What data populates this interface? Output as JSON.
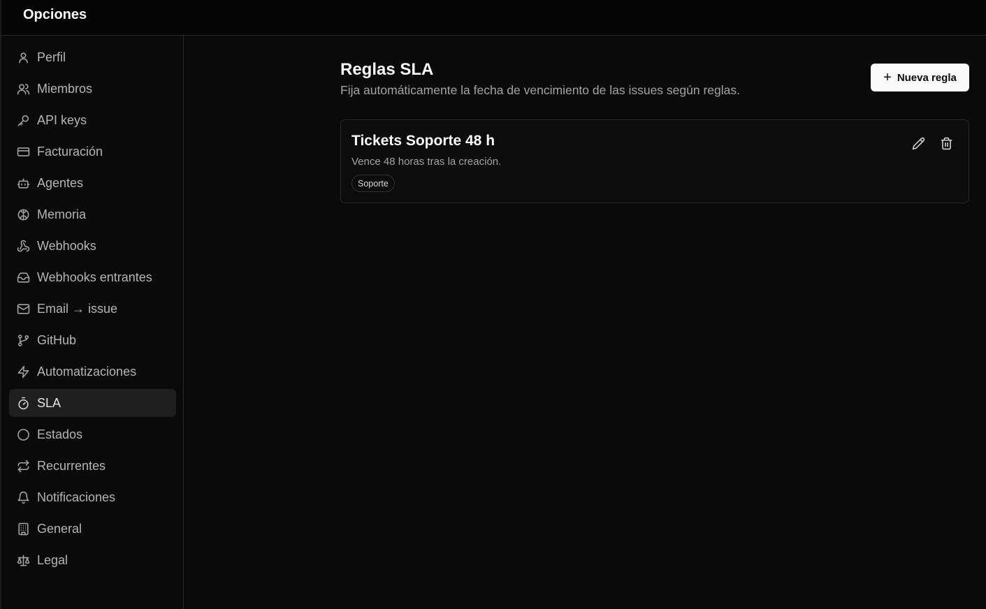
{
  "header": {
    "title": "Opciones"
  },
  "sidebar": {
    "items": [
      {
        "label": "Perfil",
        "icon": "user-icon"
      },
      {
        "label": "Miembros",
        "icon": "users-icon"
      },
      {
        "label": "API keys",
        "icon": "key-icon"
      },
      {
        "label": "Facturación",
        "icon": "credit-card-icon"
      },
      {
        "label": "Agentes",
        "icon": "bot-icon"
      },
      {
        "label": "Memoria",
        "icon": "brain-icon"
      },
      {
        "label": "Webhooks",
        "icon": "webhook-icon"
      },
      {
        "label": "Webhooks entrantes",
        "icon": "inbox-icon"
      },
      {
        "label": "Email → issue",
        "icon": "mail-icon"
      },
      {
        "label": "GitHub",
        "icon": "git-branch-icon"
      },
      {
        "label": "Automatizaciones",
        "icon": "zap-icon"
      },
      {
        "label": "SLA",
        "icon": "timer-icon",
        "active": true
      },
      {
        "label": "Estados",
        "icon": "circle-icon"
      },
      {
        "label": "Recurrentes",
        "icon": "repeat-icon"
      },
      {
        "label": "Notificaciones",
        "icon": "bell-icon"
      },
      {
        "label": "General",
        "icon": "building-icon"
      },
      {
        "label": "Legal",
        "icon": "scale-icon"
      }
    ]
  },
  "main": {
    "title": "Reglas SLA",
    "subtitle": "Fija automáticamente la fecha de vencimiento de las issues según reglas.",
    "new_button": "Nueva regla",
    "rules": [
      {
        "name": "Tickets Soporte 48 h",
        "description": "Vence 48 horas tras la creación.",
        "tag": "Soporte"
      }
    ]
  }
}
